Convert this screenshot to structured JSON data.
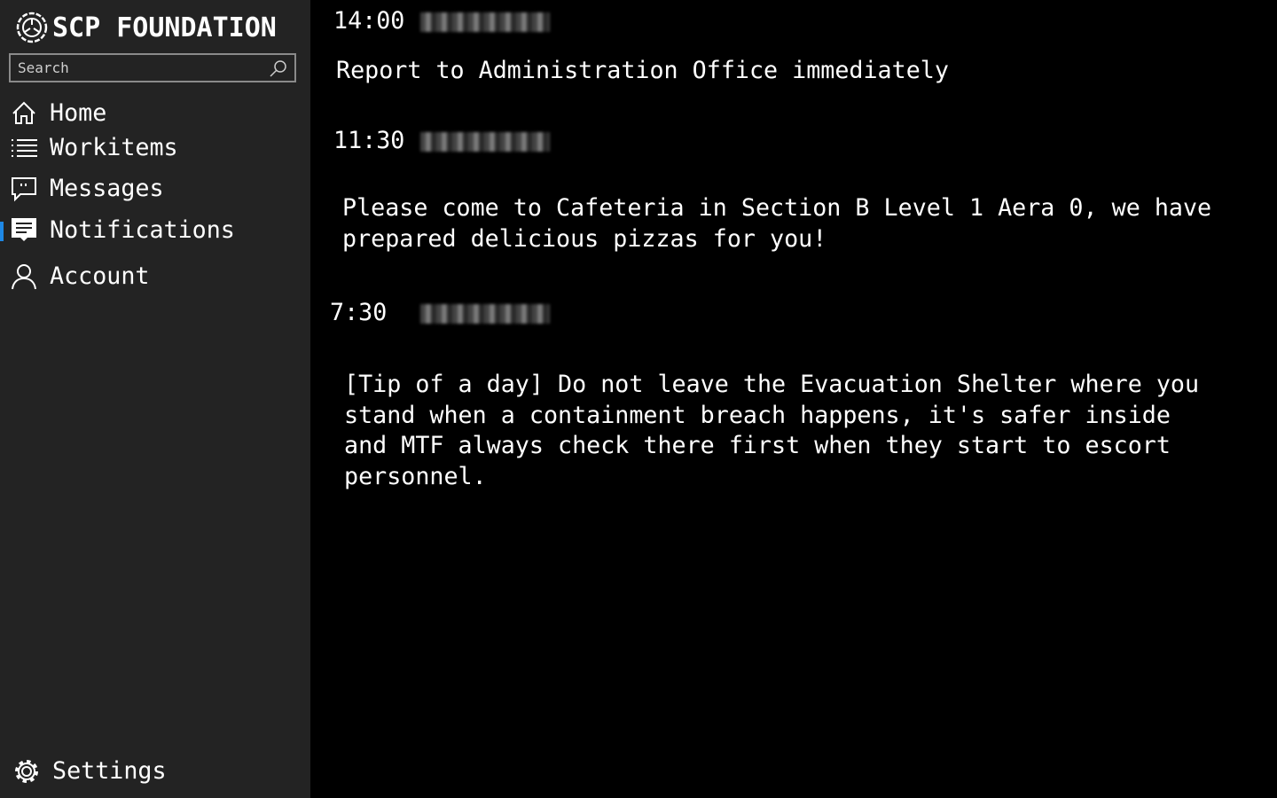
{
  "app": {
    "title": "SCP FOUNDATION",
    "logo_icon": "scp-logo"
  },
  "search": {
    "placeholder": "Search"
  },
  "nav": [
    {
      "label": "Home",
      "icon": "home-icon"
    },
    {
      "label": "Workitems",
      "icon": "list-icon"
    },
    {
      "label": "Messages",
      "icon": "message-icon"
    },
    {
      "label": "Notifications",
      "icon": "notification-icon",
      "active": true
    },
    {
      "label": "Account",
      "icon": "person-icon"
    }
  ],
  "settings": {
    "label": "Settings"
  },
  "accent": "#1e88e5",
  "notifications": [
    {
      "time": "14:00",
      "message": "Report to Administration Office immediately"
    },
    {
      "time": "11:30",
      "message": "Please come to Cafeteria in Section B Level 1 Aera 0, we have\nprepared delicious pizzas for you!"
    },
    {
      "time": "7:30",
      "message": "[Tip of a day] Do not leave the Evacuation Shelter where you\nstand when a containment breach happens, it's safer inside\nand MTF always check there first when they start to escort\npersonnel."
    }
  ]
}
